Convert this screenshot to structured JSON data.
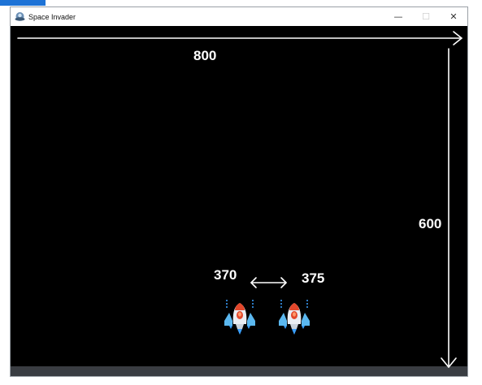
{
  "window": {
    "title": "Space Invader",
    "controls": {
      "minimize": "—",
      "maximize": "☐",
      "close": "✕"
    }
  },
  "annotations": {
    "width_label": "800",
    "height_label": "600",
    "left_position_label": "370",
    "right_position_label": "375"
  },
  "colors": {
    "background": "#000000",
    "annotation": "#ffffff",
    "ship_body": "#e9edf3",
    "ship_accent": "#e2472b",
    "ship_wing": "#5bb8f0",
    "ship_flame": "#3aa0ff"
  },
  "icons": [
    "app-icon",
    "player-ship-icon"
  ]
}
